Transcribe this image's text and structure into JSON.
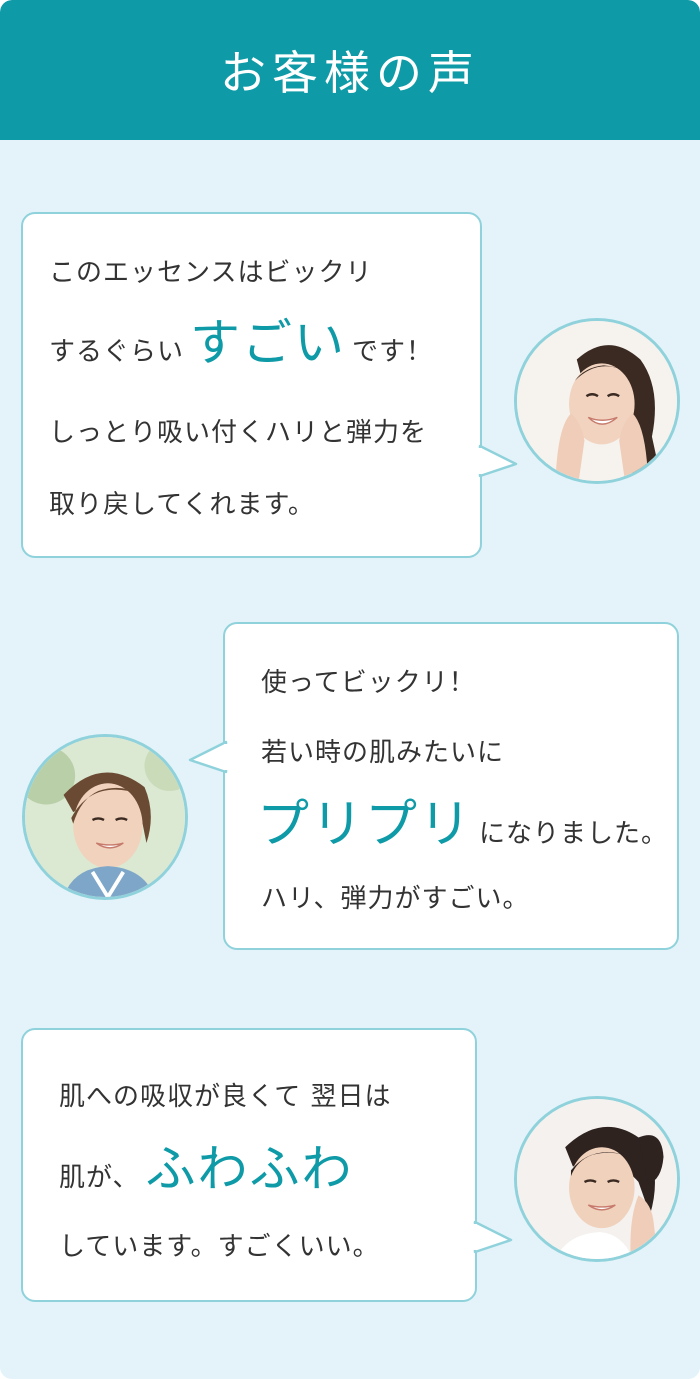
{
  "title": "お客様の声",
  "colors": {
    "header": "#0e9aa7",
    "background": "#e3f3f9",
    "accent": "#0e9aa7",
    "border": "#8fd2dc"
  },
  "testimonials": [
    {
      "line1": "このエッセンスはビックリ",
      "line2_pre": "するぐらい",
      "line2_accent": "すごい",
      "line2_post": "です！",
      "line3": "しっとり吸い付くハリと弾力を",
      "line4": "取り戻してくれます。",
      "avatar": "woman-smiling-hands-on-cheeks-photo"
    },
    {
      "line1": "使ってビックリ！",
      "line2": "若い時の肌みたいに",
      "line3_accent": "プリプリ",
      "line3_post": "になりました。",
      "line4": "ハリ、弾力がすごい。",
      "avatar": "woman-smiling-outdoors-photo"
    },
    {
      "line1": "肌への吸収が良くて  翌日は",
      "line2_pre": "肌が、",
      "line2_accent": "ふわふわ",
      "line3": "しています。すごくいい。",
      "avatar": "woman-smiling-touching-face-photo"
    }
  ]
}
